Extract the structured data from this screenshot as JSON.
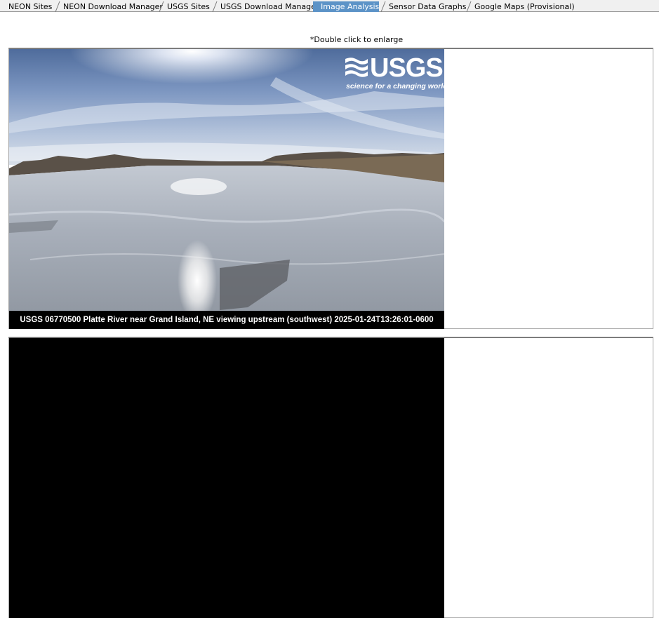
{
  "tabs": [
    {
      "label": "NEON Sites",
      "active": false
    },
    {
      "label": "NEON Download Manager",
      "active": false
    },
    {
      "label": "USGS Sites",
      "active": false
    },
    {
      "label": "USGS Download Manager",
      "active": false
    },
    {
      "label": "Image Analysis",
      "active": true
    },
    {
      "label": "Sensor Data Graphs",
      "active": false
    },
    {
      "label": "Google Maps (Provisional)",
      "active": false
    }
  ],
  "hint": "*Double click to enlarge",
  "images": [
    {
      "caption": "USGS 06770500 Platte River near Grand Island, NE viewing upstream (southwest) 2025-01-24T13:26:01-0600",
      "logo": {
        "word": "USGS",
        "tagline": "science for a changing world"
      }
    },
    {
      "caption": ""
    }
  ],
  "colors": {
    "active_tab": "#5c93c7",
    "panel_border": "#a7a7a7",
    "empty_image": "#000000"
  }
}
